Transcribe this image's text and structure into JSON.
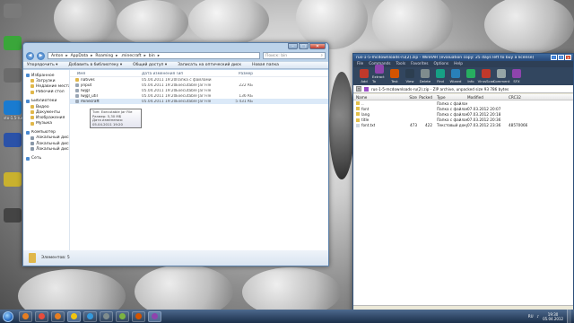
{
  "desktop": {
    "icons": [
      {
        "label": "",
        "color": "#7a7a7a"
      },
      {
        "label": "",
        "color": "#3aa63a"
      },
      {
        "label": "",
        "color": "#6b6b6b"
      },
      {
        "label": "sto-1.5-rus",
        "color": "#1a7bd0"
      },
      {
        "label": "",
        "color": "#2b52a8"
      },
      {
        "label": "",
        "color": "#c9b12e"
      },
      {
        "label": "",
        "color": "#444"
      }
    ]
  },
  "explorer": {
    "breadcrumb": [
      "Anton",
      "AppData",
      "Roaming",
      ".minecraft",
      "bin"
    ],
    "search_placeholder": "Поиск: bin",
    "toolbar": [
      "Упорядочить ▾",
      "Добавить в библиотеку ▾",
      "Общий доступ ▾",
      "Записать на оптический диск",
      "Новая папка"
    ],
    "nav": [
      {
        "label": "Избранное",
        "icon": "star-icon",
        "kind": "head"
      },
      {
        "label": "Загрузки",
        "icon": "folder-icon",
        "kind": "sub"
      },
      {
        "label": "Недавние места",
        "icon": "folder-icon",
        "kind": "sub"
      },
      {
        "label": "Рабочий стол",
        "icon": "folder-icon",
        "kind": "sub"
      },
      {
        "label": "",
        "icon": "",
        "kind": "gap"
      },
      {
        "label": "Библиотеки",
        "icon": "library-icon",
        "kind": "head"
      },
      {
        "label": "Видео",
        "icon": "video-icon",
        "kind": "sub"
      },
      {
        "label": "Документы",
        "icon": "documents-icon",
        "kind": "sub"
      },
      {
        "label": "Изображения",
        "icon": "pictures-icon",
        "kind": "sub"
      },
      {
        "label": "Музыка",
        "icon": "music-icon",
        "kind": "sub"
      },
      {
        "label": "",
        "icon": "",
        "kind": "gap"
      },
      {
        "label": "Компьютер",
        "icon": "computer-icon",
        "kind": "head"
      },
      {
        "label": "Локальный диск (C:)",
        "icon": "drive-icon",
        "kind": "sub"
      },
      {
        "label": "Локальный диск (D:)",
        "icon": "drive-icon",
        "kind": "sub"
      },
      {
        "label": "Локальный диск (E:)",
        "icon": "drive-icon",
        "kind": "sub"
      },
      {
        "label": "",
        "icon": "",
        "kind": "gap"
      },
      {
        "label": "Сеть",
        "icon": "network-icon",
        "kind": "head"
      }
    ],
    "columns": [
      "Имя",
      "Дата изменения",
      "Тип",
      "Размер"
    ],
    "files": [
      {
        "name": "natives",
        "date": "05.04.2011 19:20",
        "type": "Папка с файлами",
        "size": "",
        "kind": "folder"
      },
      {
        "name": "jinput",
        "date": "05.04.2011 19:20",
        "type": "Executable Jar File",
        "size": "222 КБ",
        "kind": "file"
      },
      {
        "name": "lwjgl",
        "date": "05.04.2011 19:20",
        "type": "Executable Jar File",
        "size": "",
        "kind": "file"
      },
      {
        "name": "lwjgl_util",
        "date": "05.04.2011 19:20",
        "type": "Executable Jar File",
        "size": "136 КБ",
        "kind": "file"
      },
      {
        "name": "minecraft",
        "date": "05.04.2011 19:20",
        "type": "Executable Jar File",
        "size": "5 431 КБ",
        "kind": "file"
      }
    ],
    "tooltip": [
      "Тип: Executable Jar File",
      "Размер: 5,30 МБ",
      "Дата изменения: 05.04.2011 19:20"
    ],
    "status": "Элементов: 5"
  },
  "winrar": {
    "title": "rus-1-5-mcdownloads-ru(2).zip - WinRAR (evaluation copy: 25 days left to buy a license)",
    "menu": [
      "File",
      "Commands",
      "Tools",
      "Favorites",
      "Options",
      "Help"
    ],
    "tools": [
      {
        "label": "Add",
        "color": "#c0392b"
      },
      {
        "label": "Extract To",
        "color": "#8e44ad"
      },
      {
        "label": "Test",
        "color": "#d35400"
      },
      {
        "label": "View",
        "color": "#2c3e50"
      },
      {
        "label": "Delete",
        "color": "#7f8c8d"
      },
      {
        "label": "Find",
        "color": "#16a085"
      },
      {
        "label": "Wizard",
        "color": "#2980b9"
      },
      {
        "label": "Info",
        "color": "#27ae60"
      },
      {
        "label": "VirusScan",
        "color": "#c0392b"
      },
      {
        "label": "Comment",
        "color": "#95a5a6"
      },
      {
        "label": "SFX",
        "color": "#8e44ad"
      }
    ],
    "path": "rus-1-5-mcdownloads-ru(2).zip - ZIP archive, unpacked size 93 786 bytes",
    "columns": [
      "Name",
      "Size",
      "Packed",
      "Type",
      "Modified",
      "CRC32"
    ],
    "rows": [
      {
        "name": "..",
        "size": "",
        "packed": "",
        "type": "Папка с файлами",
        "modified": "",
        "crc": "",
        "kind": "folder"
      },
      {
        "name": "font",
        "size": "",
        "packed": "",
        "type": "Папка с файлами",
        "modified": "07.03.2012 20:07",
        "crc": "",
        "kind": "folder"
      },
      {
        "name": "lang",
        "size": "",
        "packed": "",
        "type": "Папка с файлами",
        "modified": "07.03.2012 20:18",
        "crc": "",
        "kind": "folder"
      },
      {
        "name": "title",
        "size": "",
        "packed": "",
        "type": "Папка с файлами",
        "modified": "07.03.2012 20:36",
        "crc": "",
        "kind": "folder"
      },
      {
        "name": "font.txt",
        "size": "473",
        "packed": "422",
        "type": "Текстовый доку...",
        "modified": "07.03.2012 23:36",
        "crc": "48570066",
        "kind": "txt"
      }
    ]
  },
  "taskbar": {
    "buttons": [
      {
        "icon": "media-player-icon",
        "color": "#e67e22"
      },
      {
        "icon": "opera-icon",
        "color": "#e74c3c"
      },
      {
        "icon": "firefox-icon",
        "color": "#e67e22"
      },
      {
        "icon": "explorer-icon",
        "color": "#f1c40f"
      },
      {
        "icon": "skype-icon",
        "color": "#3498db"
      },
      {
        "icon": "settings-icon",
        "color": "#7f8c8d"
      },
      {
        "icon": "minecraft-icon",
        "color": "#7cb342"
      },
      {
        "icon": "recorder-icon",
        "color": "#d35400"
      },
      {
        "icon": "winrar-icon",
        "color": "#8e44ad"
      }
    ],
    "lang": "RU",
    "time": "19:30",
    "date": "05.04.2012"
  }
}
